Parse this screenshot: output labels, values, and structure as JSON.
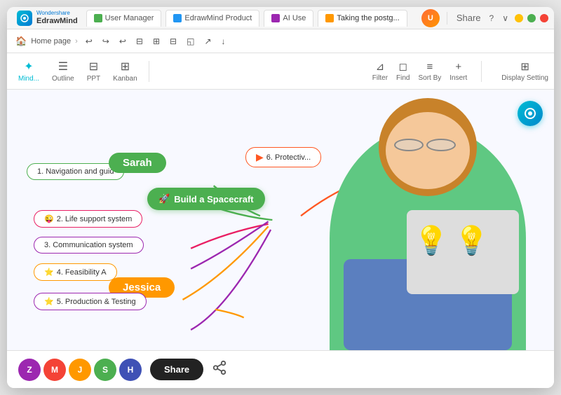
{
  "window": {
    "title": "EdrawMind",
    "brand_top": "Wondershare",
    "brand_bottom": "EdrawMind"
  },
  "tabs": [
    {
      "label": "User Manager",
      "type": "user",
      "active": false
    },
    {
      "label": "EdrawMind Product",
      "type": "product",
      "active": false
    },
    {
      "label": "AI Use",
      "type": "ai",
      "active": false
    },
    {
      "label": "Taking the postg...",
      "type": "taking",
      "active": true
    }
  ],
  "breadcrumb": "Home page",
  "toolbar_actions": [
    "↩",
    "↪",
    "↩",
    "◻",
    "⊞",
    "⊟",
    "◱",
    "↗",
    "↓"
  ],
  "view_modes": [
    {
      "label": "Mind...",
      "icon": "✦",
      "active": true
    },
    {
      "label": "Outline",
      "icon": "☰",
      "active": false
    },
    {
      "label": "PPT",
      "icon": "⊟",
      "active": false
    },
    {
      "label": "Kanban",
      "icon": "⊞⊞",
      "active": false
    }
  ],
  "right_toolbar": [
    {
      "label": "Filter",
      "icon": "⊿"
    },
    {
      "label": "Find",
      "icon": "◻"
    },
    {
      "label": "Sort By",
      "icon": "≡"
    },
    {
      "label": "Insert",
      "icon": "+"
    },
    {
      "label": "Display Setting",
      "icon": "⊞"
    }
  ],
  "mind_map": {
    "center_node": "Build a Spacecraft",
    "center_icon": "🚀",
    "nodes": [
      {
        "id": 1,
        "label": "1. Navigation and guid",
        "type": "nav"
      },
      {
        "id": 2,
        "label": "2. Life support system",
        "type": "life",
        "emoji": "😜"
      },
      {
        "id": 3,
        "label": "3. Communication system",
        "type": "comm"
      },
      {
        "id": 4,
        "label": "4. Feasibility A",
        "type": "feas",
        "emoji": "⭐"
      },
      {
        "id": 5,
        "label": "5. Production & Testing",
        "type": "prod",
        "emoji": "⭐"
      },
      {
        "id": 6,
        "label": "6. Protectiv...",
        "type": "prot"
      }
    ],
    "name_tags": [
      {
        "name": "Sarah",
        "color": "#4caf50"
      },
      {
        "name": "Jessica",
        "color": "#ff9800"
      }
    ]
  },
  "bottom_bar": {
    "avatars": [
      {
        "letter": "Z",
        "color": "#9c27b0"
      },
      {
        "letter": "M",
        "color": "#f44336"
      },
      {
        "letter": "J",
        "color": "#ff9800"
      },
      {
        "letter": "S",
        "color": "#4caf50"
      },
      {
        "letter": "H",
        "color": "#3f51b5"
      }
    ],
    "share_btn": "Share"
  },
  "share_top": "Share",
  "window_controls": {
    "minimize": "−",
    "maximize": "□",
    "close": "✕"
  }
}
